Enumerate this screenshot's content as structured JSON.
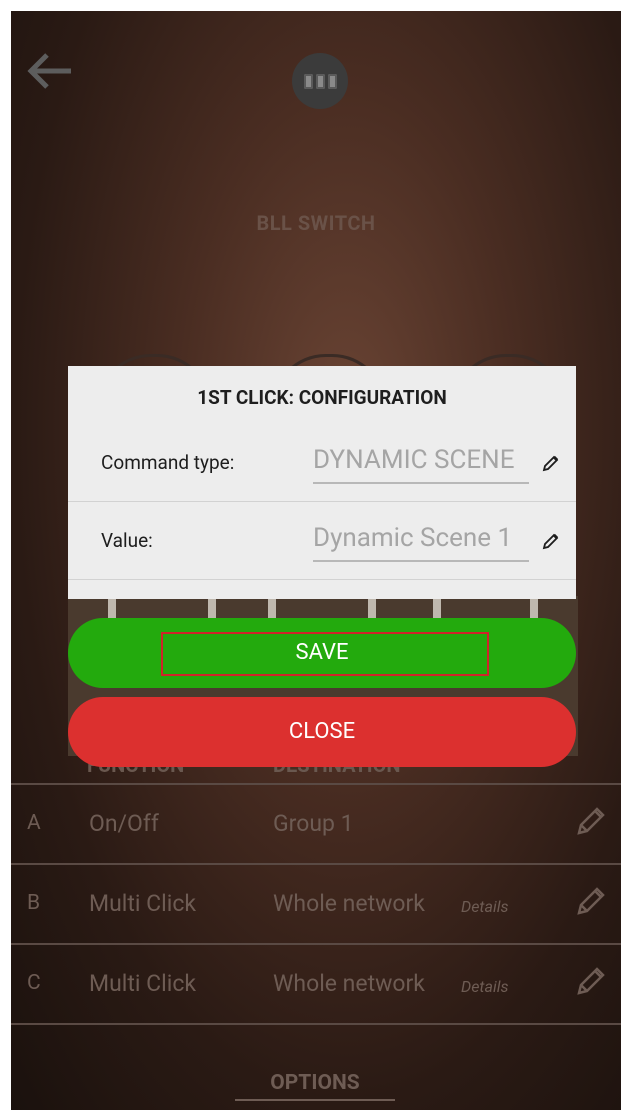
{
  "header": {
    "title": "BLL SWITCH",
    "back_icon": "arrow-left-icon",
    "device_icon": "switch-device-icon"
  },
  "background_table": {
    "columns": [
      "FUNCTION",
      "DESTINATION"
    ],
    "rows": [
      {
        "letter": "A",
        "function": "On/Off",
        "destination": "Group 1",
        "details": ""
      },
      {
        "letter": "B",
        "function": "Multi Click",
        "destination": "Whole network",
        "details": "Details"
      },
      {
        "letter": "C",
        "function": "Multi Click",
        "destination": "Whole network",
        "details": "Details"
      }
    ],
    "options_label": "OPTIONS"
  },
  "modal": {
    "title": "1ST CLICK: CONFIGURATION",
    "command_type_label": "Command type:",
    "command_type_value": "DYNAMIC SCENE",
    "value_label": "Value:",
    "value_value": "Dynamic Scene 1",
    "save_label": "SAVE",
    "close_label": "CLOSE"
  },
  "colors": {
    "save": "#23aa0d",
    "close": "#dc302f",
    "highlight": "#d0242a"
  }
}
